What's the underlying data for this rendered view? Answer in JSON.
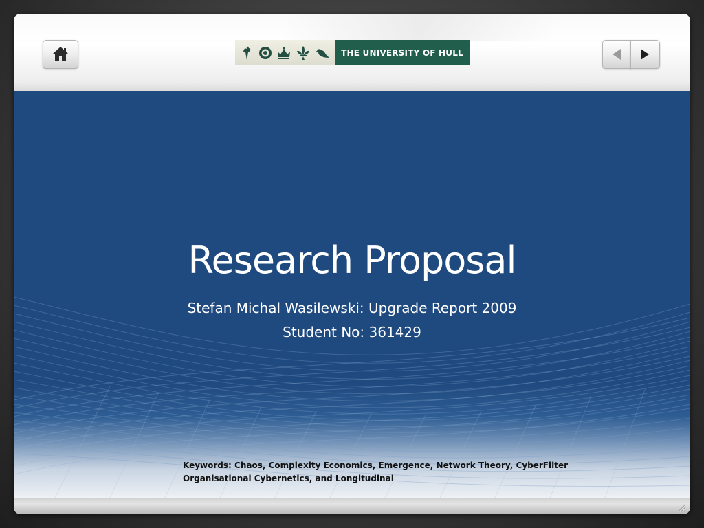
{
  "navigation": {
    "home_icon": "home-icon",
    "prev_icon": "triangle-left-icon",
    "next_icon": "triangle-right-icon"
  },
  "logo": {
    "text": "THE UNIVERSITY OF HULL",
    "crest_icons": [
      "torch-icon",
      "rose-icon",
      "crown-icon",
      "fleur-de-lis-icon",
      "bird-icon"
    ],
    "colors": {
      "text_background": "#225e4c",
      "crest_background": "#e6e6da",
      "crest_ink": "#234f42"
    }
  },
  "slide": {
    "title": "Research Proposal",
    "subtitle_line1": "Stefan Michal Wasilewski: Upgrade Report 2009",
    "subtitle_line2": "Student No: 361429",
    "keywords_line1": "Keywords: Chaos, Complexity Economics, Emergence, Network Theory, CyberFilter",
    "keywords_line2": "Organisational Cybernetics, and Longitudinal",
    "colors": {
      "background": "#1f4a80",
      "title_text": "#ffffff",
      "keywords_text": "#111111"
    }
  }
}
